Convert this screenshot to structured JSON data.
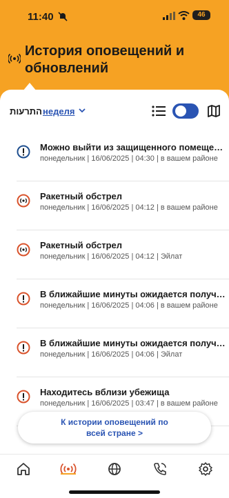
{
  "status_bar": {
    "time": "11:40",
    "battery": "46"
  },
  "header": {
    "title": "История оповещений и обновлений"
  },
  "filter": {
    "label": "התרעות",
    "value": "неделя"
  },
  "colors": {
    "accent": "#f6a223",
    "link": "#2a54b3",
    "info": "#1f4f8f",
    "warning": "#d9532c"
  },
  "alerts": [
    {
      "title": "Можно выйти из защищенного помещения",
      "meta": "понедельник | 16/06/2025 | 04:30 | в вашем районе",
      "icon": "info-icon"
    },
    {
      "title": "Ракетный обстрел",
      "meta": "понедельник | 16/06/2025 | 04:12 | в вашем районе",
      "icon": "rocket-alert-icon"
    },
    {
      "title": "Ракетный обстрел",
      "meta": "понедельник | 16/06/2025 | 04:12 | Эйлат",
      "icon": "rocket-alert-icon"
    },
    {
      "title": "В ближайшие минуты ожидается получе...",
      "meta": "понедельник | 16/06/2025 | 04:06 | в вашем районе",
      "icon": "warning-icon"
    },
    {
      "title": "В ближайшие минуты ожидается получе...",
      "meta": "понедельник | 16/06/2025 | 04:06 | Эйлат",
      "icon": "warning-icon"
    },
    {
      "title": "Находитесь вблизи убежища",
      "meta": "понедельник | 16/06/2025 | 03:47 | в вашем районе",
      "icon": "warning-icon"
    }
  ],
  "country_button": {
    "line1": "К истории оповещений по",
    "line2": "всей стране >"
  },
  "tabs": [
    "home-icon",
    "alerts-icon",
    "globe-icon",
    "phone-icon",
    "settings-icon"
  ]
}
